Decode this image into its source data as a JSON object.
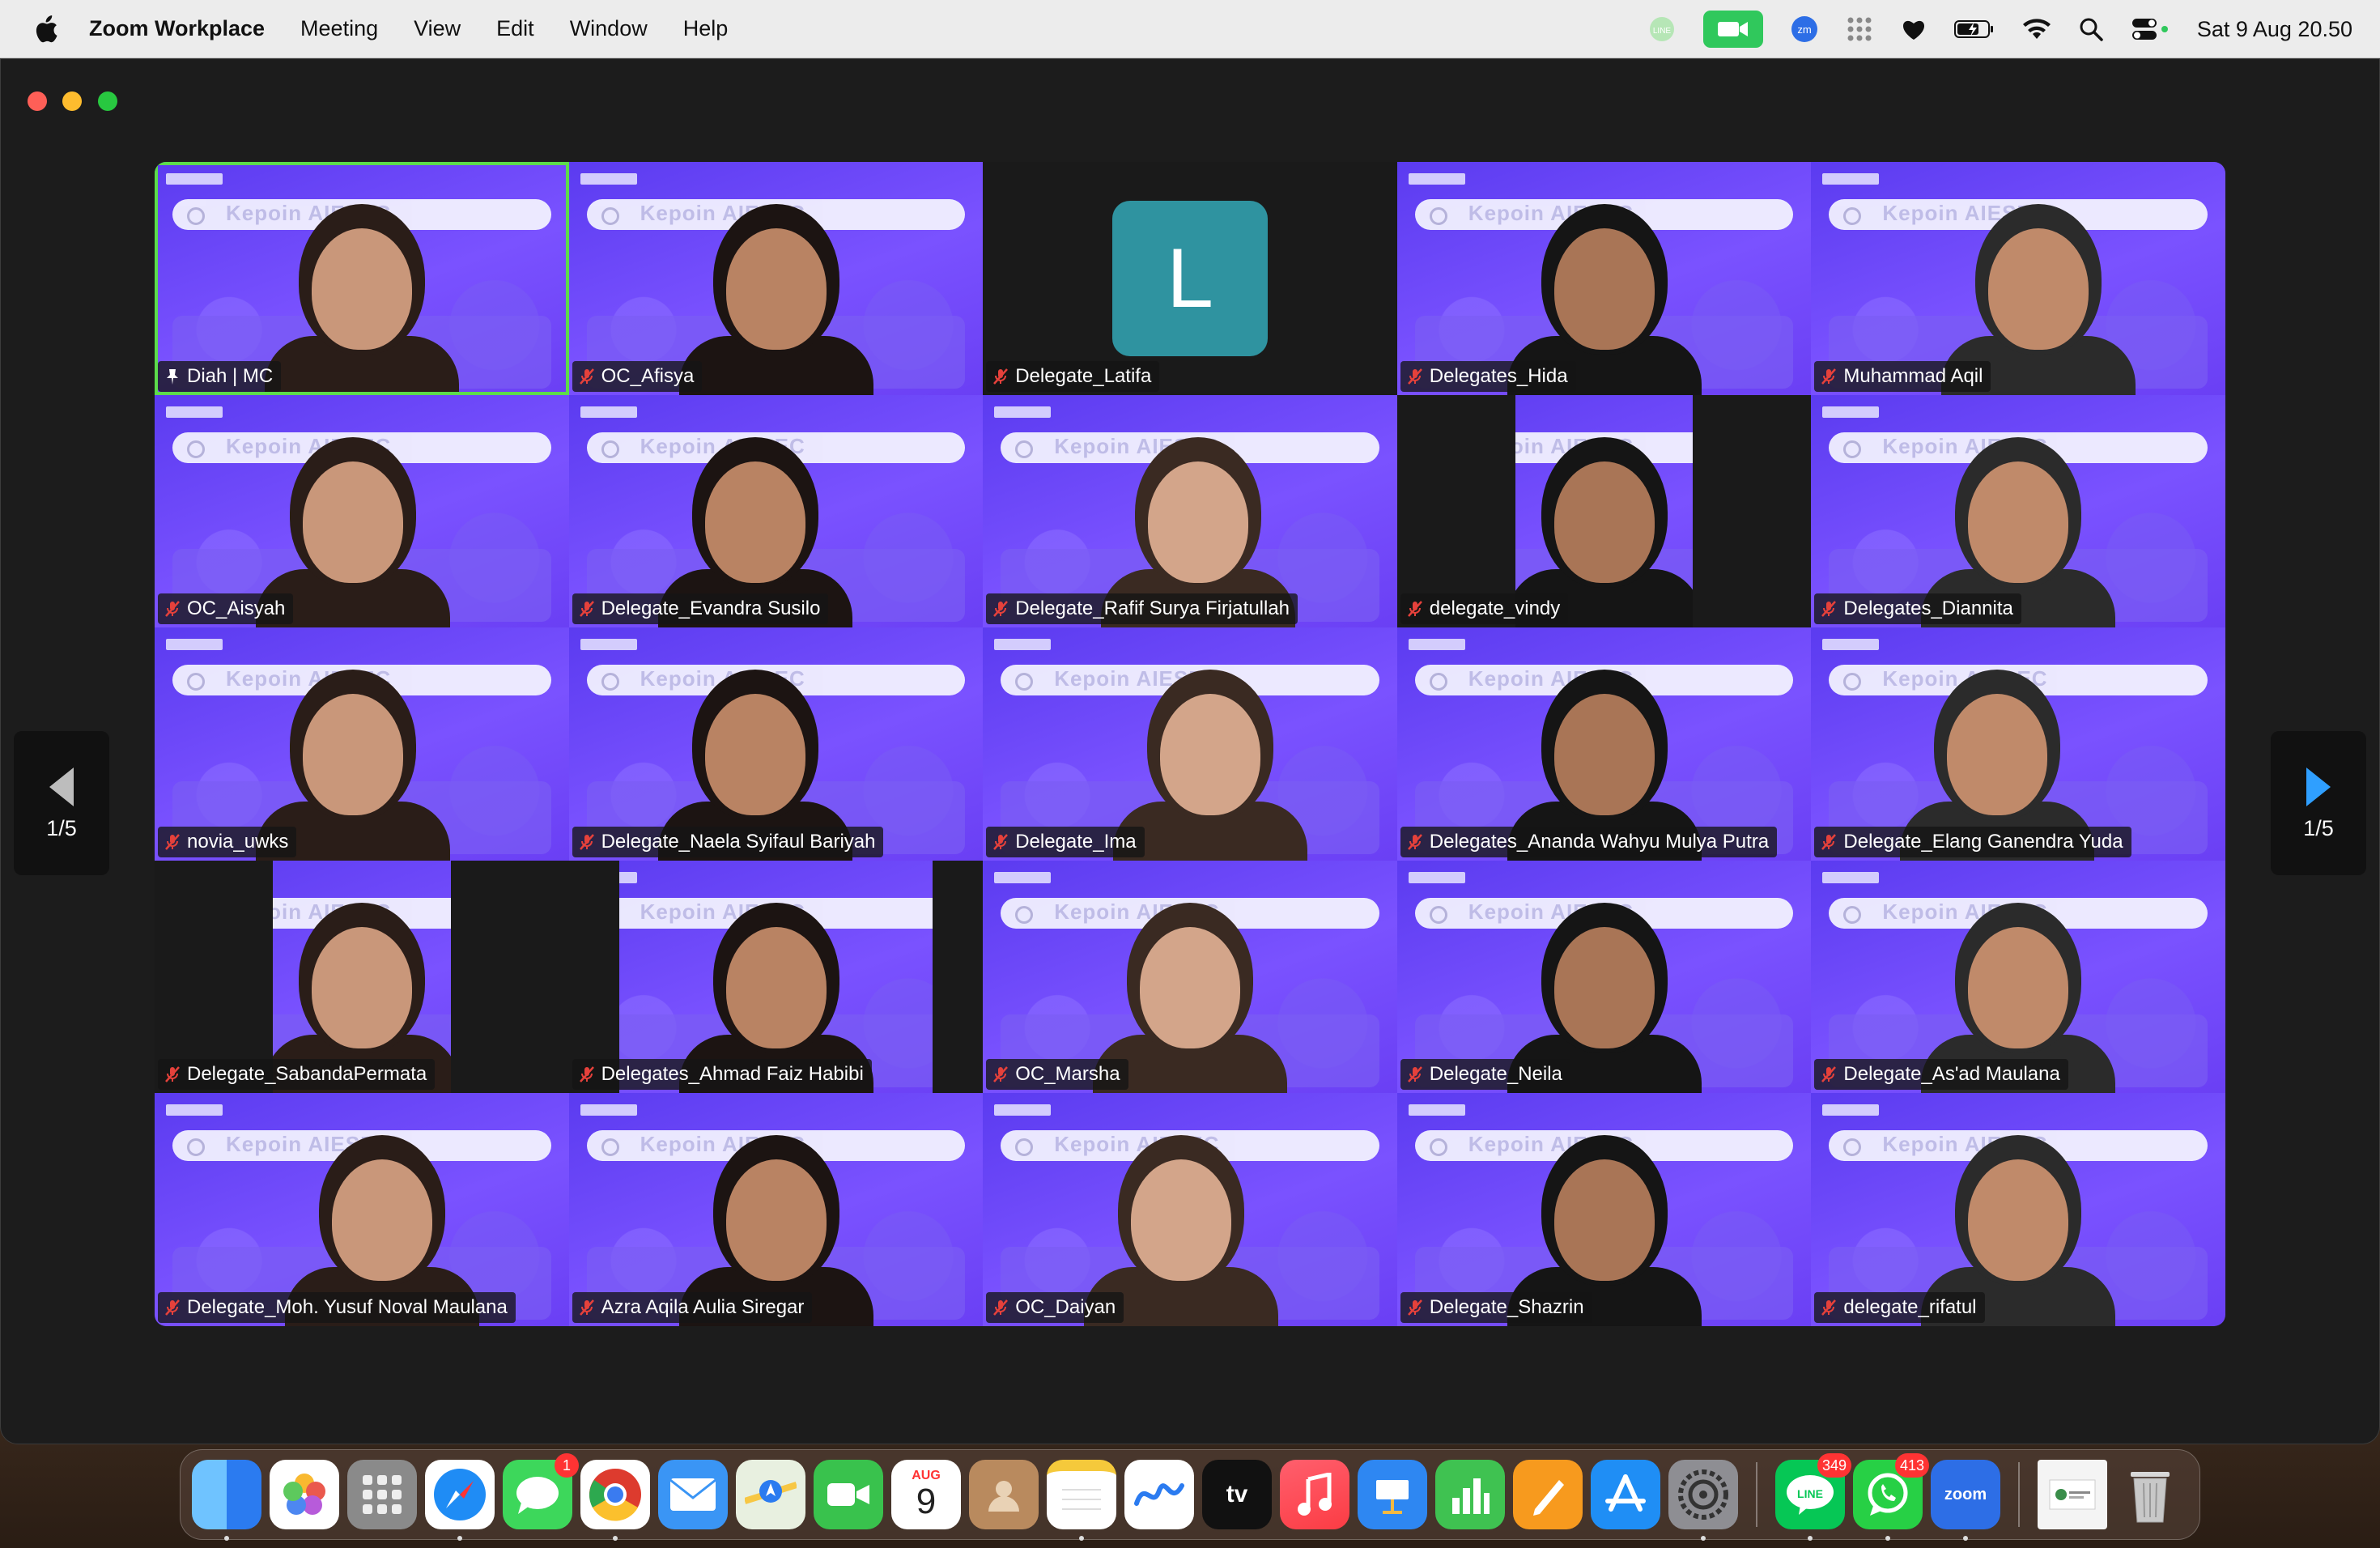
{
  "menubar": {
    "app_name": "Zoom Workplace",
    "items": [
      "Meeting",
      "View",
      "Edit",
      "Window",
      "Help"
    ],
    "clock": "Sat 9 Aug  20.50"
  },
  "pager": {
    "left_label": "1/5",
    "right_label": "1/5"
  },
  "participants": [
    {
      "name": "Diah | MC",
      "pinned": true,
      "active": true
    },
    {
      "name": "OC_Afisya",
      "muted": true
    },
    {
      "name": "Delegate_Latifa",
      "muted": true,
      "avatar_letter": "L"
    },
    {
      "name": "Delegates_Hida",
      "muted": true
    },
    {
      "name": "Muhammad Aqil",
      "muted": true
    },
    {
      "name": "OC_Aisyah",
      "muted": true
    },
    {
      "name": "Delegate_Evandra Susilo",
      "muted": true
    },
    {
      "name": "Delegate_Rafif Surya Firjatullah",
      "muted": true
    },
    {
      "name": "delegate_vindy",
      "muted": true
    },
    {
      "name": "Delegates_Diannita",
      "muted": true
    },
    {
      "name": "novia_uwks",
      "muted": true
    },
    {
      "name": "Delegate_Naela Syifaul Bariyah",
      "muted": true
    },
    {
      "name": "Delegate_Ima",
      "muted": true
    },
    {
      "name": "Delegates_Ananda Wahyu Mulya Putra",
      "muted": true
    },
    {
      "name": "Delegate_Elang Ganendra Yuda",
      "muted": true
    },
    {
      "name": "Delegate_SabandaPermata",
      "muted": true
    },
    {
      "name": "Delegates_Ahmad Faiz Habibi",
      "muted": true
    },
    {
      "name": "OC_Marsha",
      "muted": true
    },
    {
      "name": "Delegate_Neila",
      "muted": true
    },
    {
      "name": "Delegate_As'ad Maulana",
      "muted": true
    },
    {
      "name": "Delegate_Moh. Yusuf Noval Maulana",
      "muted": true
    },
    {
      "name": "Azra Aqila Aulia Siregar",
      "muted": true
    },
    {
      "name": "OC_Daiyan",
      "muted": true
    },
    {
      "name": "Delegate_Shazrin",
      "muted": true
    },
    {
      "name": "delegate_rifatul",
      "muted": true
    }
  ],
  "background_search_text": "Kepoin AIESEC",
  "dock": {
    "messages_badge": "1",
    "calendar_month": "AUG",
    "calendar_day": "9",
    "appletv_label": "tv",
    "line_badge": "349",
    "line_label": "LINE",
    "whatsapp_badge": "413",
    "zoom_label": "zoom"
  },
  "colors": {
    "active_speaker": "#5ddb4b",
    "zoom_camera_green": "#30c85c",
    "latifa_avatar": "#2f93a0",
    "tile_purple": "#6a47e8"
  }
}
